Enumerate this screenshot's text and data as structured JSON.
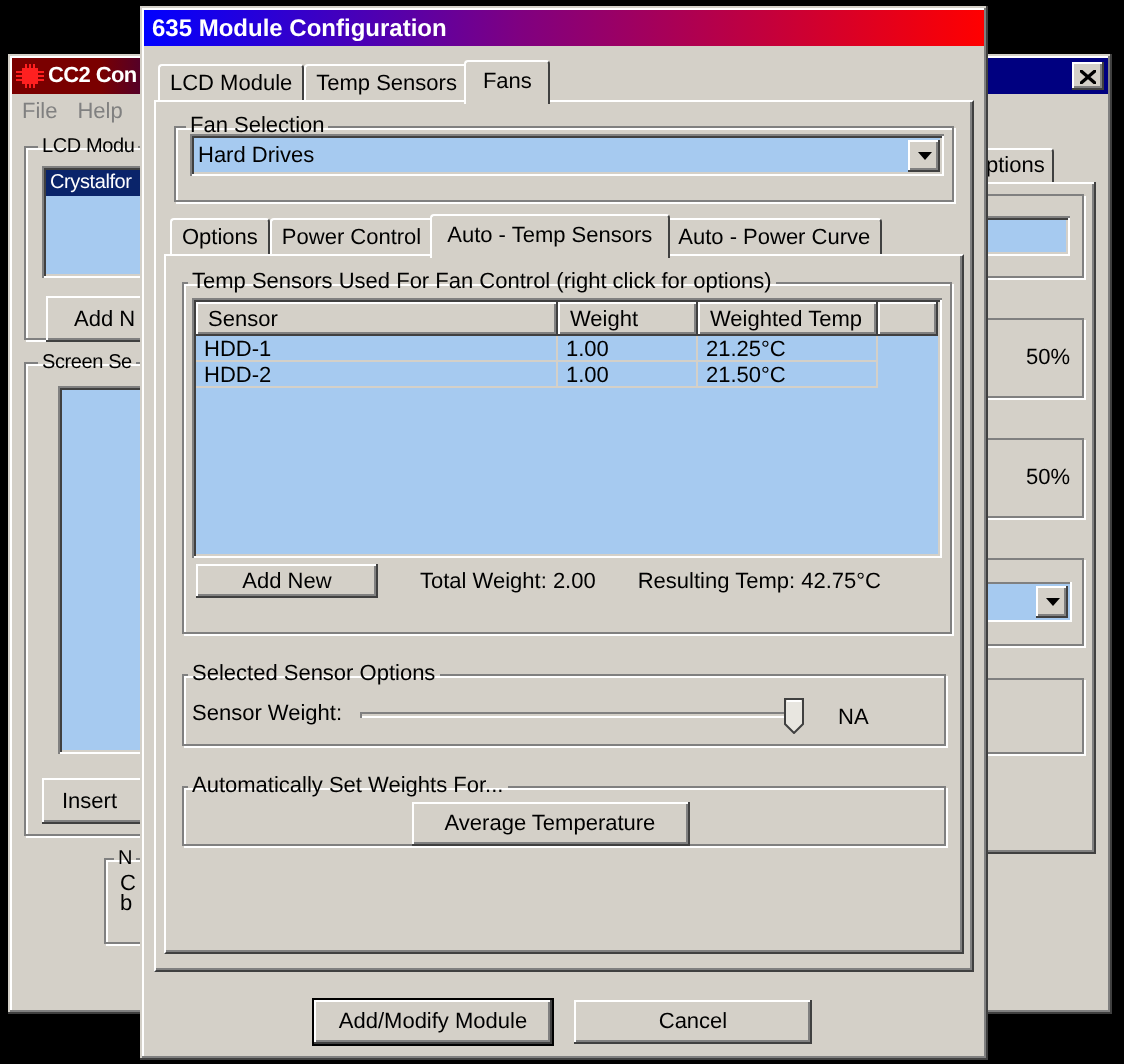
{
  "back_window": {
    "title": "CC2 Con",
    "menu": [
      {
        "label": "File"
      },
      {
        "label": "Help"
      }
    ],
    "lcd_group": {
      "label": "LCD Modu",
      "items": [
        {
          "label": "Crystalfor",
          "selected": true
        }
      ],
      "button": "Add N"
    },
    "screen_group": {
      "label": "Screen Se",
      "button": "Insert"
    },
    "notes_group": {
      "label": "N",
      "lines": [
        "C",
        "b"
      ]
    },
    "tab": {
      "label": "ptions"
    },
    "readings": [
      "50%",
      "50%"
    ]
  },
  "dialog": {
    "title": "635 Module Configuration",
    "tabs": [
      {
        "label": "LCD Module",
        "selected": false
      },
      {
        "label": "Temp Sensors",
        "selected": false
      },
      {
        "label": "Fans",
        "selected": true
      }
    ],
    "fan_selection": {
      "label": "Fan Selection",
      "value": "Hard Drives"
    },
    "sub_tabs": [
      {
        "label": "Options",
        "selected": false
      },
      {
        "label": "Power Control",
        "selected": false
      },
      {
        "label": "Auto - Temp Sensors",
        "selected": true
      },
      {
        "label": "Auto - Power Curve",
        "selected": false
      }
    ],
    "sensors_group": {
      "label": "Temp Sensors Used For Fan Control (right click for options)",
      "columns": [
        "Sensor",
        "Weight",
        "Weighted Temp"
      ],
      "rows": [
        [
          "HDD-1",
          "1.00",
          "21.25°C"
        ],
        [
          "HDD-2",
          "1.00",
          "21.50°C"
        ]
      ],
      "add_button": "Add New",
      "total_weight": "Total Weight: 2.00",
      "resulting_temp": "Resulting Temp: 42.75°C"
    },
    "sensor_options": {
      "label": "Selected Sensor Options",
      "field_label": "Sensor Weight:",
      "level": 1.0,
      "reading": "NA"
    },
    "auto_weights": {
      "label": "Automatically Set Weights For...",
      "button": "Average Temperature"
    },
    "buttons": [
      {
        "label": "Add/Modify Module",
        "default": true
      },
      {
        "label": "Cancel",
        "default": false
      }
    ]
  }
}
